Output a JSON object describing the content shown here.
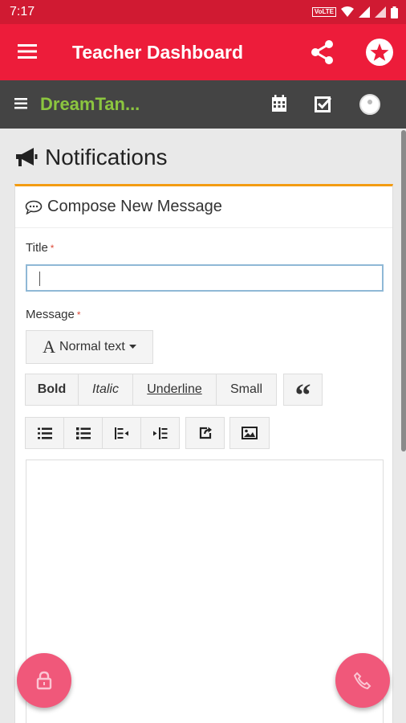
{
  "statusbar": {
    "time": "7:17",
    "volte": "VoLTE"
  },
  "appbar": {
    "title": "Teacher Dashboard"
  },
  "subbar": {
    "brand": "DreamTan..."
  },
  "page": {
    "title": "Notifications"
  },
  "compose": {
    "header": "Compose New Message",
    "title_label": "Title",
    "title_value": "",
    "message_label": "Message",
    "required_mark": "*"
  },
  "toolbar": {
    "font_style": "Normal text",
    "font_icon": "A",
    "bold": "Bold",
    "italic": "Italic",
    "underline": "Underline",
    "small": "Small",
    "quote": "“"
  },
  "icons": {
    "menu": "menu-icon",
    "share": "share-icon",
    "star": "star-icon",
    "calendar": "calendar-icon",
    "check": "checkbox-icon",
    "megaphone": "megaphone-icon",
    "comment": "comment-icon",
    "lock": "lock-icon",
    "phone": "phone-icon"
  },
  "colors": {
    "statusbar": "#d01a32",
    "appbar": "#ed1c3a",
    "subbar": "#444444",
    "brand": "#8cc63f",
    "card_accent": "#f39c12",
    "fab": "#f0587a"
  }
}
